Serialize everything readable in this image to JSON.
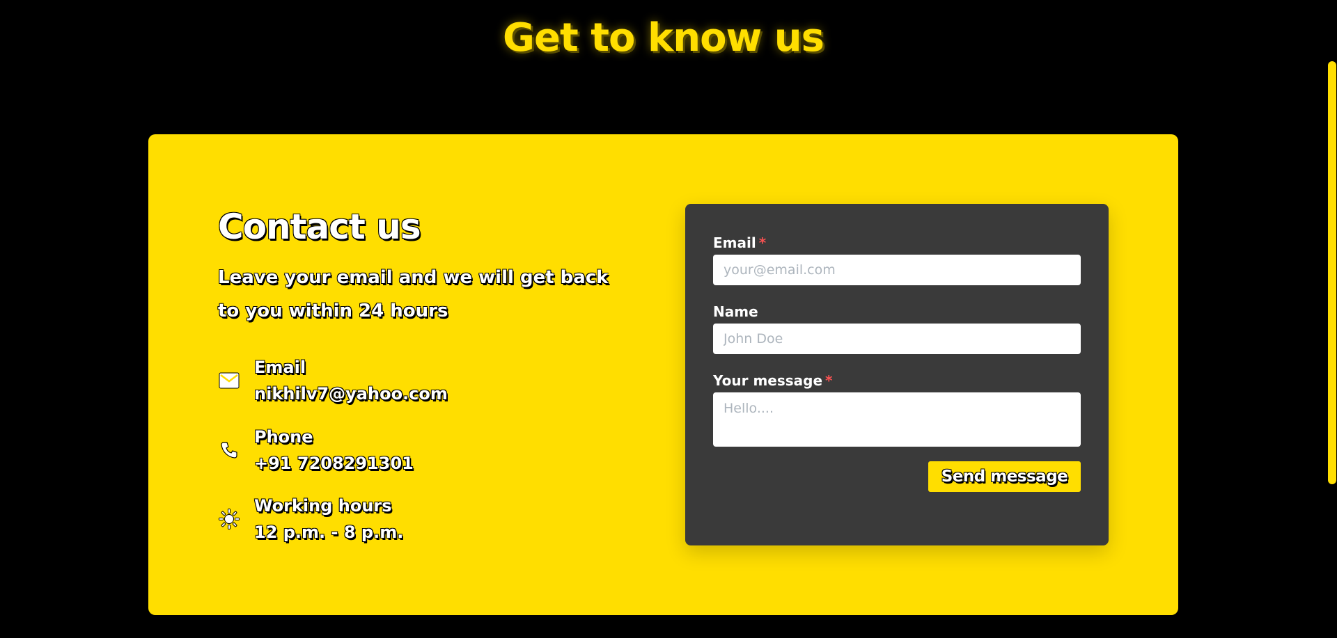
{
  "colors": {
    "background": "#000000",
    "accent": "#FFDE00",
    "form_background": "#3a3a3a",
    "required_marker": "#fa5252"
  },
  "page": {
    "title": "Get to know us"
  },
  "contact": {
    "title": "Contact us",
    "description": "Leave your email and we will get back to you within 24 hours",
    "items": [
      {
        "icon": "mail-icon",
        "label": "Email",
        "value": "nikhilv7@yahoo.com"
      },
      {
        "icon": "phone-icon",
        "label": "Phone",
        "value": "+91 7208291301"
      },
      {
        "icon": "sun-icon",
        "label": "Working hours",
        "value": "12 p.m. - 8 p.m."
      }
    ]
  },
  "form": {
    "email_label": "Email",
    "email_placeholder": "your@email.com",
    "name_label": "Name",
    "name_placeholder": "John Doe",
    "message_label": "Your message",
    "message_placeholder": "Hello....",
    "required_marker": "*",
    "submit_label": "Send message"
  }
}
